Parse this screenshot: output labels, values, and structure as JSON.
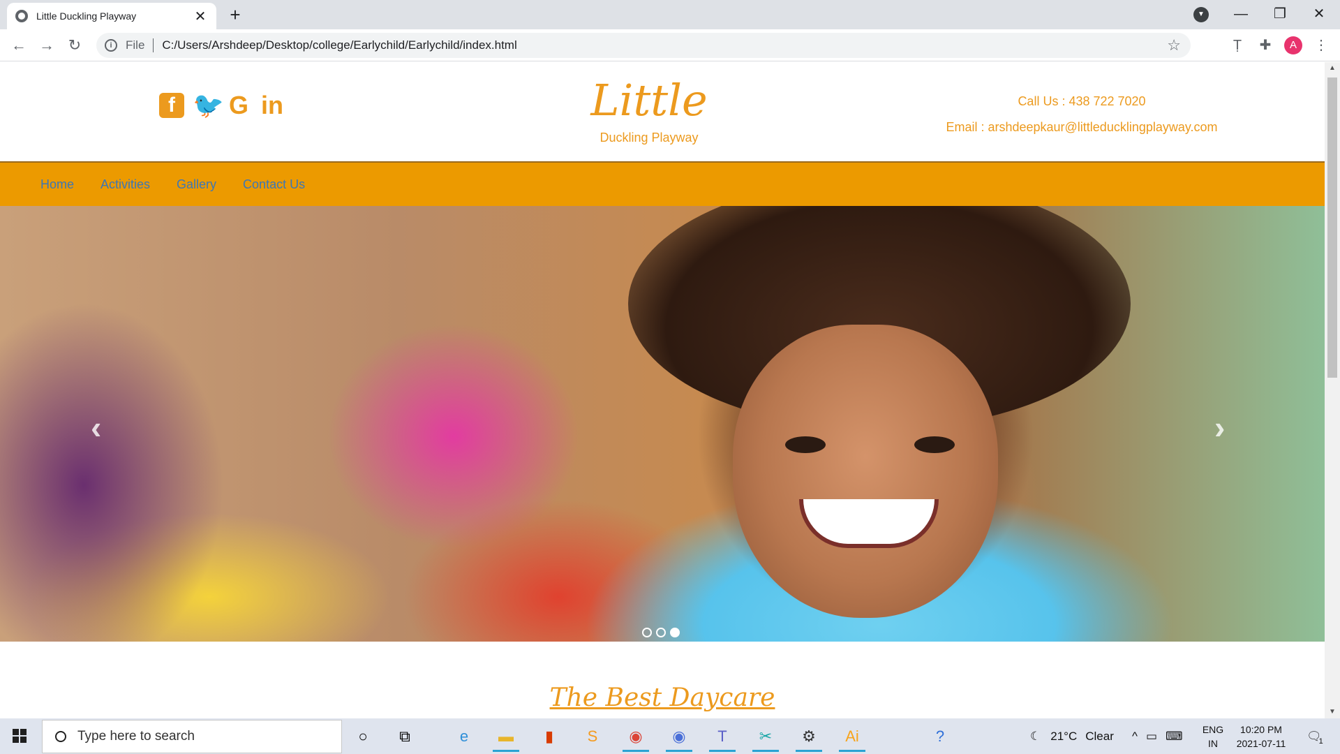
{
  "browser": {
    "tab_title": "Little Duckling Playway",
    "tab_close": "✕",
    "new_tab": "+",
    "scheme_label": "File",
    "url": "C:/Users/Arshdeep/Desktop/college/Earlychild/Earlychild/index.html",
    "profile_initial": "A",
    "window_controls": {
      "minimize": "—",
      "restore": "❐",
      "close": "✕"
    }
  },
  "site": {
    "logo_main": "Little",
    "logo_sub": "Duckling Playway",
    "call": "Call Us : 438 722 7020",
    "email": "Email : arshdeepkaur@littleducklingplayway.com",
    "social_icons": [
      "facebook-icon",
      "twitter-icon",
      "google-icon",
      "linkedin-icon"
    ],
    "nav": [
      "Home",
      "Activities",
      "Gallery",
      "Contact Us"
    ],
    "carousel": {
      "slides": 3,
      "active_slide": 3,
      "prev": "‹",
      "next": "›"
    },
    "section_title": "The Best Daycare",
    "colors": {
      "accent": "#ec9a1e",
      "navbar": "#ec9a00",
      "nav_link": "#3d77b6"
    }
  },
  "taskbar": {
    "search_placeholder": "Type here to search",
    "weather_temp": "21°C",
    "weather_desc": "Clear",
    "lang_top": "ENG",
    "lang_bottom": "IN",
    "time": "10:20 PM",
    "date": "2021-07-11",
    "notification_count": "1",
    "apps": [
      "cortana-icon",
      "task-view-icon",
      "edge-icon",
      "file-explorer-icon",
      "office-icon",
      "sublime-icon",
      "chrome-icon",
      "chrome-alt-icon",
      "teams-icon",
      "snip-icon",
      "settings-icon",
      "illustrator-icon"
    ]
  }
}
